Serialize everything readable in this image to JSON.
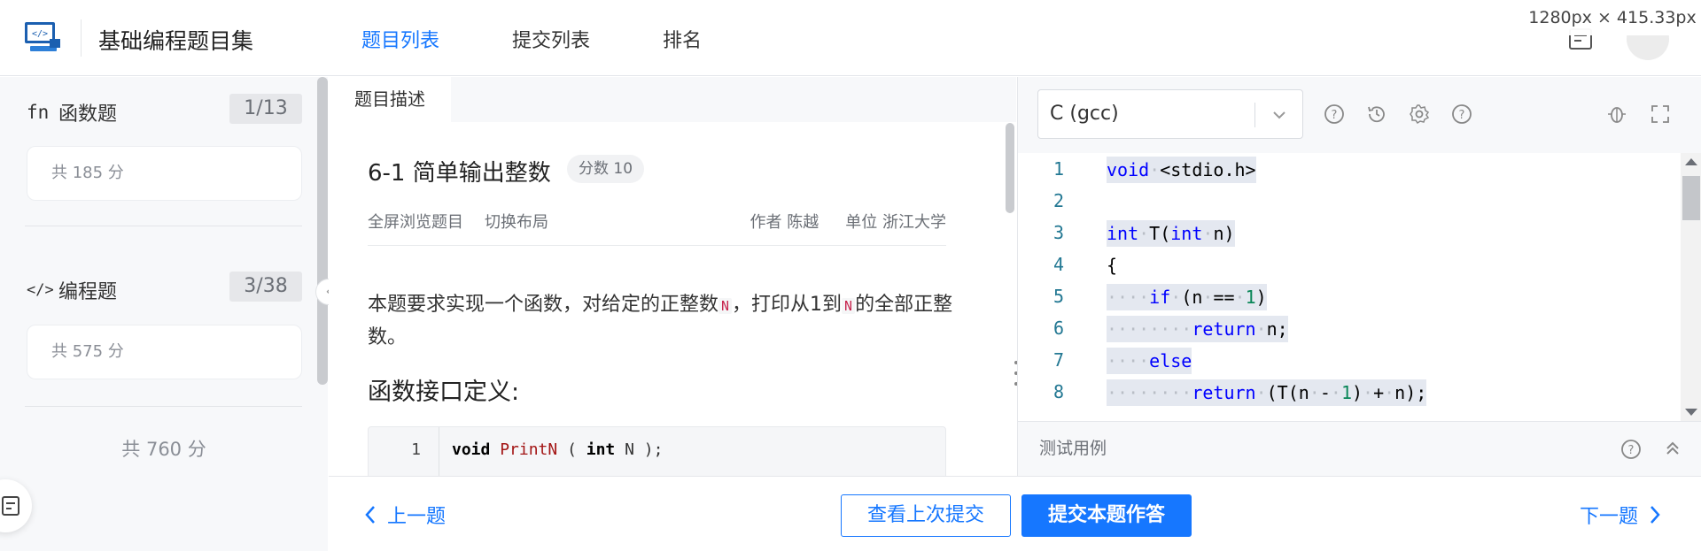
{
  "header": {
    "app_title": "基础编程题目集",
    "tabs": [
      {
        "label": "题目列表",
        "active": true
      },
      {
        "label": "提交列表",
        "active": false
      },
      {
        "label": "排名",
        "active": false
      }
    ],
    "size_badge": "1280px × 415.33px"
  },
  "sidebar": {
    "categories": [
      {
        "icon": "fn",
        "name": "函数题",
        "count": "1/13",
        "score": "共 185 分"
      },
      {
        "icon": "</>",
        "name": "编程题",
        "count": "3/38",
        "score": "共 575 分"
      }
    ],
    "total": "共 760 分"
  },
  "problem": {
    "tab": "题目描述",
    "title": "6-1 简单输出整数",
    "score_tag": "分数 10",
    "actions": [
      "全屏浏览题目",
      "切换布局"
    ],
    "author": "作者 陈越",
    "unit": "单位 浙江大学",
    "desc_prefix": "本题要求实现一个函数，对给定的正整数",
    "desc_var1": "N",
    "desc_mid": "，打印从1到",
    "desc_var2": "N",
    "desc_suffix": "的全部正整数。",
    "section_title": "函数接口定义:",
    "code_line_no": "1",
    "code_kw1": "void",
    "code_fn": "PrintN",
    "code_open": " ( ",
    "code_kw2": "int",
    "code_rest": " N );"
  },
  "editor": {
    "language": "C (gcc)",
    "lines": [
      {
        "no": "1"
      },
      {
        "no": "2"
      },
      {
        "no": "3"
      },
      {
        "no": "4"
      },
      {
        "no": "5"
      },
      {
        "no": "6"
      },
      {
        "no": "7"
      },
      {
        "no": "8"
      }
    ],
    "testcase_label": "测试用例"
  },
  "footer": {
    "prev": "上一题",
    "view_last": "查看上次提交",
    "submit": "提交本题作答",
    "next": "下一题"
  },
  "colors": {
    "accent": "#1677ff",
    "keyword": "#0000ff",
    "number": "#098658"
  }
}
